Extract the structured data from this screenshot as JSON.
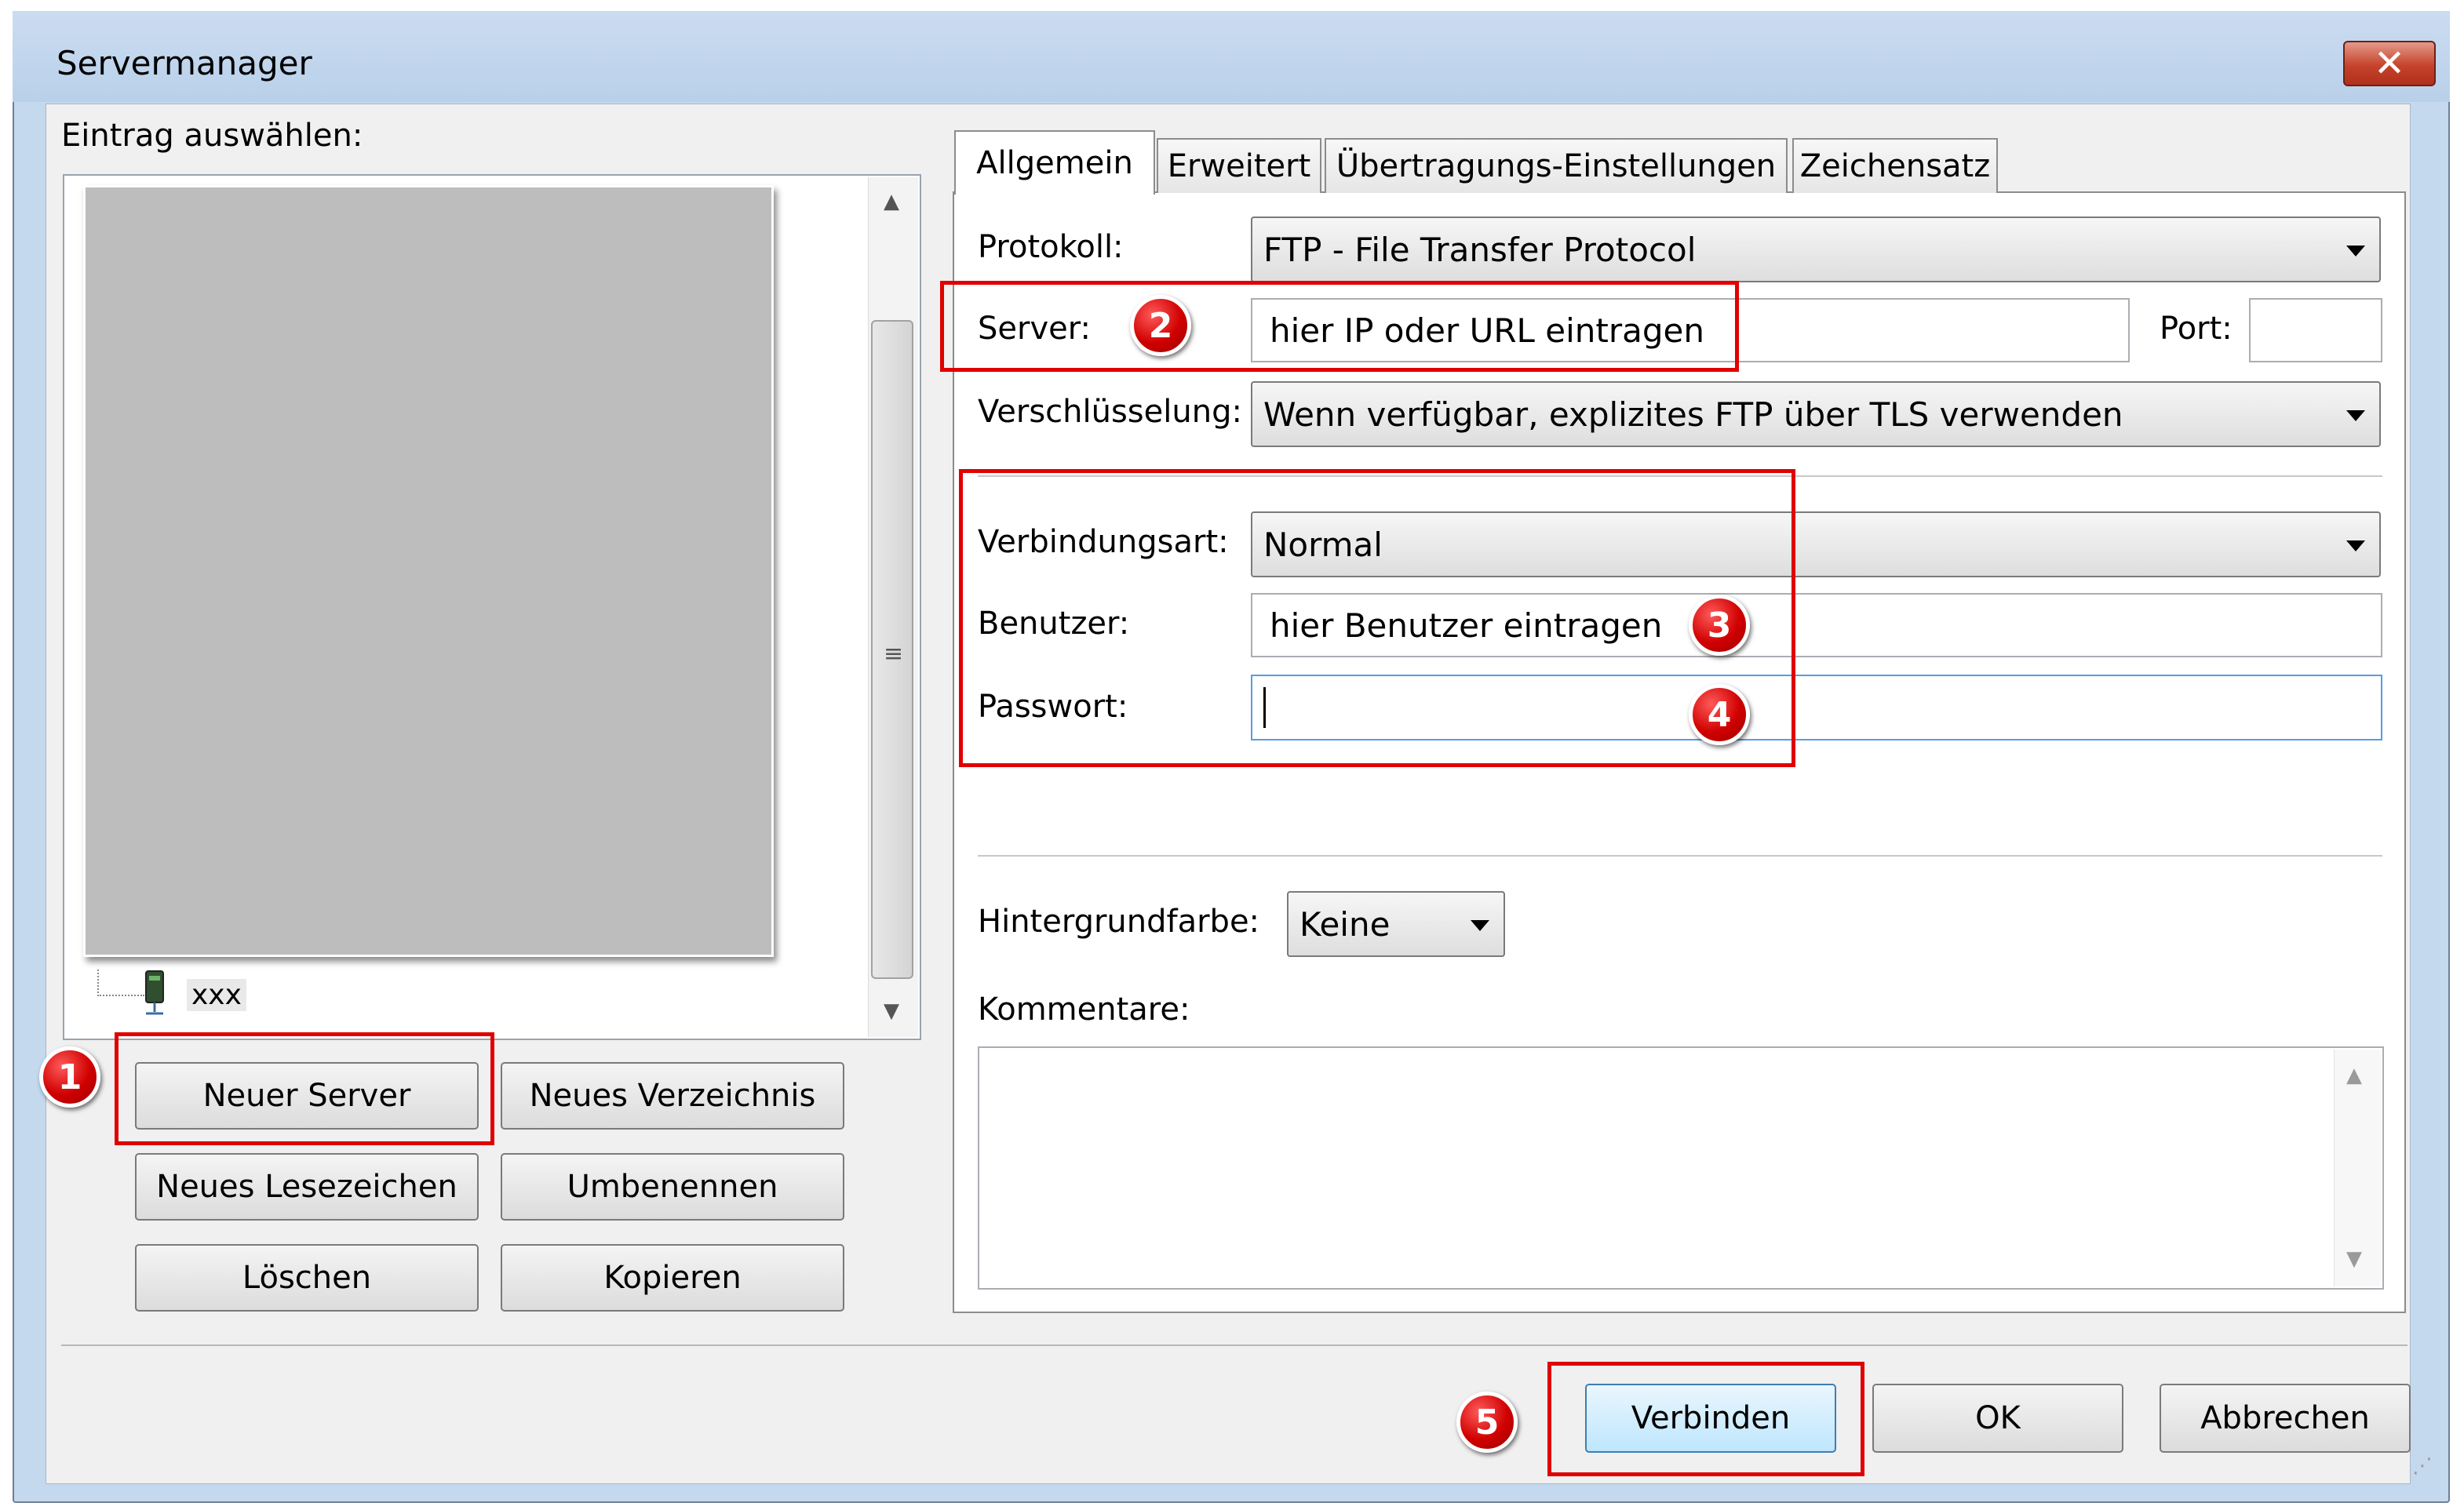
{
  "window": {
    "title": "Servermanager",
    "close_icon": "close-icon"
  },
  "left": {
    "label": "Eintrag auswählen:",
    "tree_item": "xxx",
    "buttons": {
      "new_server": "Neuer Server",
      "new_folder": "Neues Verzeichnis",
      "new_bookmark": "Neues Lesezeichen",
      "rename": "Umbenennen",
      "delete": "Löschen",
      "copy": "Kopieren"
    }
  },
  "tabs": [
    "Allgemein",
    "Erweitert",
    "Übertragungs-Einstellungen",
    "Zeichensatz"
  ],
  "general": {
    "protocol_label": "Protokoll:",
    "protocol_value": "FTP - File Transfer Protocol",
    "server_label": "Server:",
    "server_value": "hier IP oder URL eintragen",
    "port_label": "Port:",
    "port_value": "",
    "encryption_label": "Verschlüsselung:",
    "encryption_value": "Wenn verfügbar, explizites FTP über TLS verwenden",
    "logon_label": "Verbindungsart:",
    "logon_value": "Normal",
    "user_label": "Benutzer:",
    "user_value": "hier Benutzer eintragen",
    "password_label": "Passwort:",
    "password_value": "",
    "bgcolor_label": "Hintergrundfarbe:",
    "bgcolor_value": "Keine",
    "comments_label": "Kommentare:",
    "comments_value": ""
  },
  "footer": {
    "connect": "Verbinden",
    "ok": "OK",
    "cancel": "Abbrechen"
  },
  "annotations": [
    "1",
    "2",
    "3",
    "4",
    "5"
  ],
  "colors": {
    "annotation": "#e00000",
    "title_bar": "#c4d9ee",
    "close_button": "#c5432b"
  }
}
